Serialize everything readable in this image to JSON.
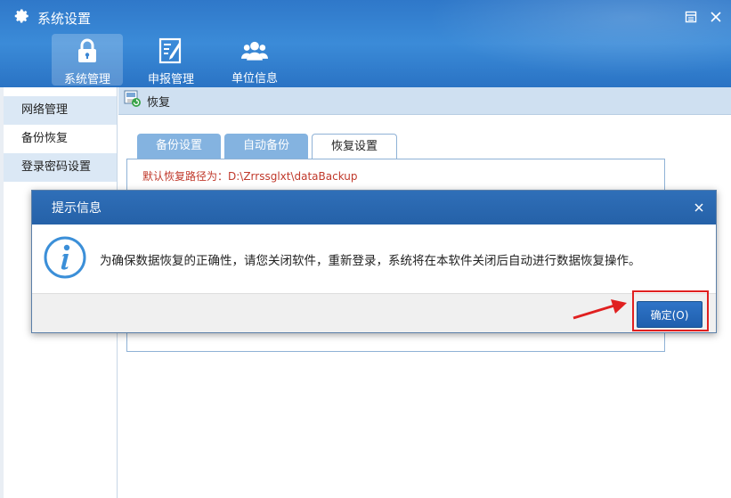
{
  "window": {
    "title": "系统设置"
  },
  "nav": [
    {
      "label": "系统管理",
      "icon": "lock-icon",
      "active": true
    },
    {
      "label": "申报管理",
      "icon": "edit-doc-icon",
      "active": false
    },
    {
      "label": "单位信息",
      "icon": "users-icon",
      "active": false
    }
  ],
  "sidebar": {
    "items": [
      {
        "label": "网络管理",
        "selected": true
      },
      {
        "label": "备份恢复",
        "selected": false
      },
      {
        "label": "登录密码设置",
        "selected": true
      }
    ]
  },
  "content": {
    "header": "恢复",
    "tabs": [
      {
        "label": "备份设置",
        "active": false
      },
      {
        "label": "自动备份",
        "active": false
      },
      {
        "label": "恢复设置",
        "active": true
      }
    ],
    "restore_path": "默认恢复路径为：D:\\Zrrssglxt\\dataBackup"
  },
  "dialog": {
    "title": "提示信息",
    "message": "为确保数据恢复的正确性，请您关闭软件，重新登录，系统将在本软件关闭后自动进行数据恢复操作。",
    "ok_label": "确定(O)"
  },
  "colors": {
    "accent": "#2f78c9",
    "highlight": "#e02020",
    "path_text": "#c0392b"
  }
}
